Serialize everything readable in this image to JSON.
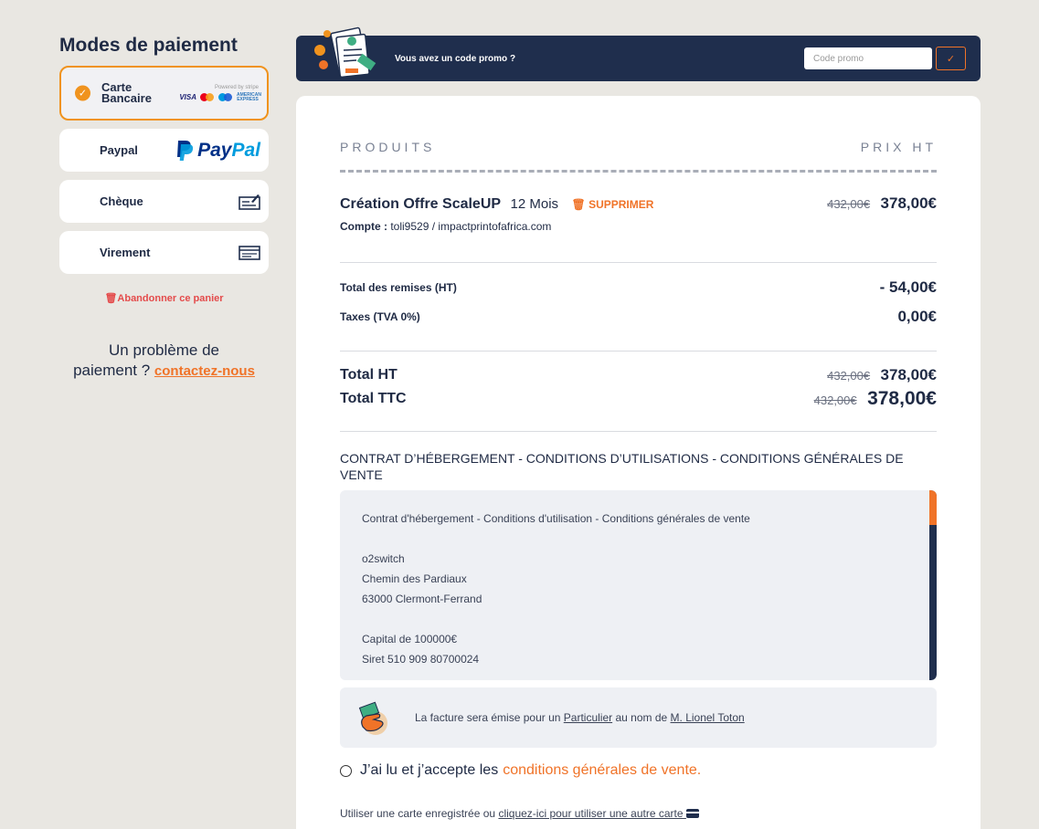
{
  "payment": {
    "title": "Modes de paiement",
    "options": [
      {
        "label_line1": "Carte",
        "label_line2": "Bancaire",
        "selected": true,
        "check_icon": "check-icon",
        "logos": {
          "stripe": "Powered by stripe",
          "visa": "VISA",
          "amex": "AMERICAN EXPRESS"
        }
      },
      {
        "label": "Paypal",
        "logo": "PayPal",
        "logo_pay": "Pay",
        "logo_pal": "Pal"
      },
      {
        "label": "Chèque",
        "icon": "cheque-icon"
      },
      {
        "label": "Virement",
        "icon": "transfer-icon"
      }
    ],
    "abandon": "Abandonner ce panier",
    "problem_text_1": "Un problème de",
    "problem_text_2": "paiement ?",
    "contact_link": "contactez-nous"
  },
  "promo": {
    "question": "Vous avez un code promo ?",
    "placeholder": "Code promo",
    "submit_icon": "check-icon"
  },
  "cart": {
    "col_products": "PRODUITS",
    "col_price": "PRIX HT",
    "product": {
      "name": "Création Offre ScaleUP",
      "duration": "12 Mois",
      "delete_label": "SUPPRIMER",
      "old_price": "432,00€",
      "price": "378,00€",
      "account_label": "Compte :",
      "account_value": "toli9529 / impactprintofafrica.com"
    },
    "discounts_label": "Total des remises (HT)",
    "discounts_value": "- 54,00€",
    "taxes_label": "Taxes (TVA 0%)",
    "taxes_value": "0,00€",
    "total_ht_label": "Total HT",
    "total_ht_old": "432,00€",
    "total_ht_value": "378,00€",
    "total_ttc_label": "Total TTC",
    "total_ttc_old": "432,00€",
    "total_ttc_value": "378,00€"
  },
  "terms": {
    "title": "CONTRAT D’HÉBERGEMENT - CONDITIONS D’UTILISATIONS - CONDITIONS GÉNÉRALES DE VENTE",
    "lines": {
      "l1": "Contrat d'hébergement - Conditions d'utilisation - Conditions générales de vente",
      "l2": "o2switch",
      "l3": "Chemin des Pardiaux",
      "l4": "63000 Clermont-Ferrand",
      "l5": "Capital de 100000€",
      "l6": "Siret 510 909 80700024"
    }
  },
  "invoice": {
    "prefix": "La facture sera émise pour un",
    "type": "Particulier",
    "middle": "au nom de",
    "name": "M. Lionel Toton"
  },
  "accept": {
    "text": "J’ai lu et j’accepte les",
    "link": "conditions générales de vente",
    "suffix": "."
  },
  "saved_card": {
    "text": "Utiliser une carte enregistrée ou",
    "link": "cliquez-ici pour utiliser une autre carte"
  },
  "colors": {
    "accent": "#f07328",
    "selected_border": "#f0931e",
    "navy": "#1f2e4d",
    "background": "#e9e7e2"
  }
}
